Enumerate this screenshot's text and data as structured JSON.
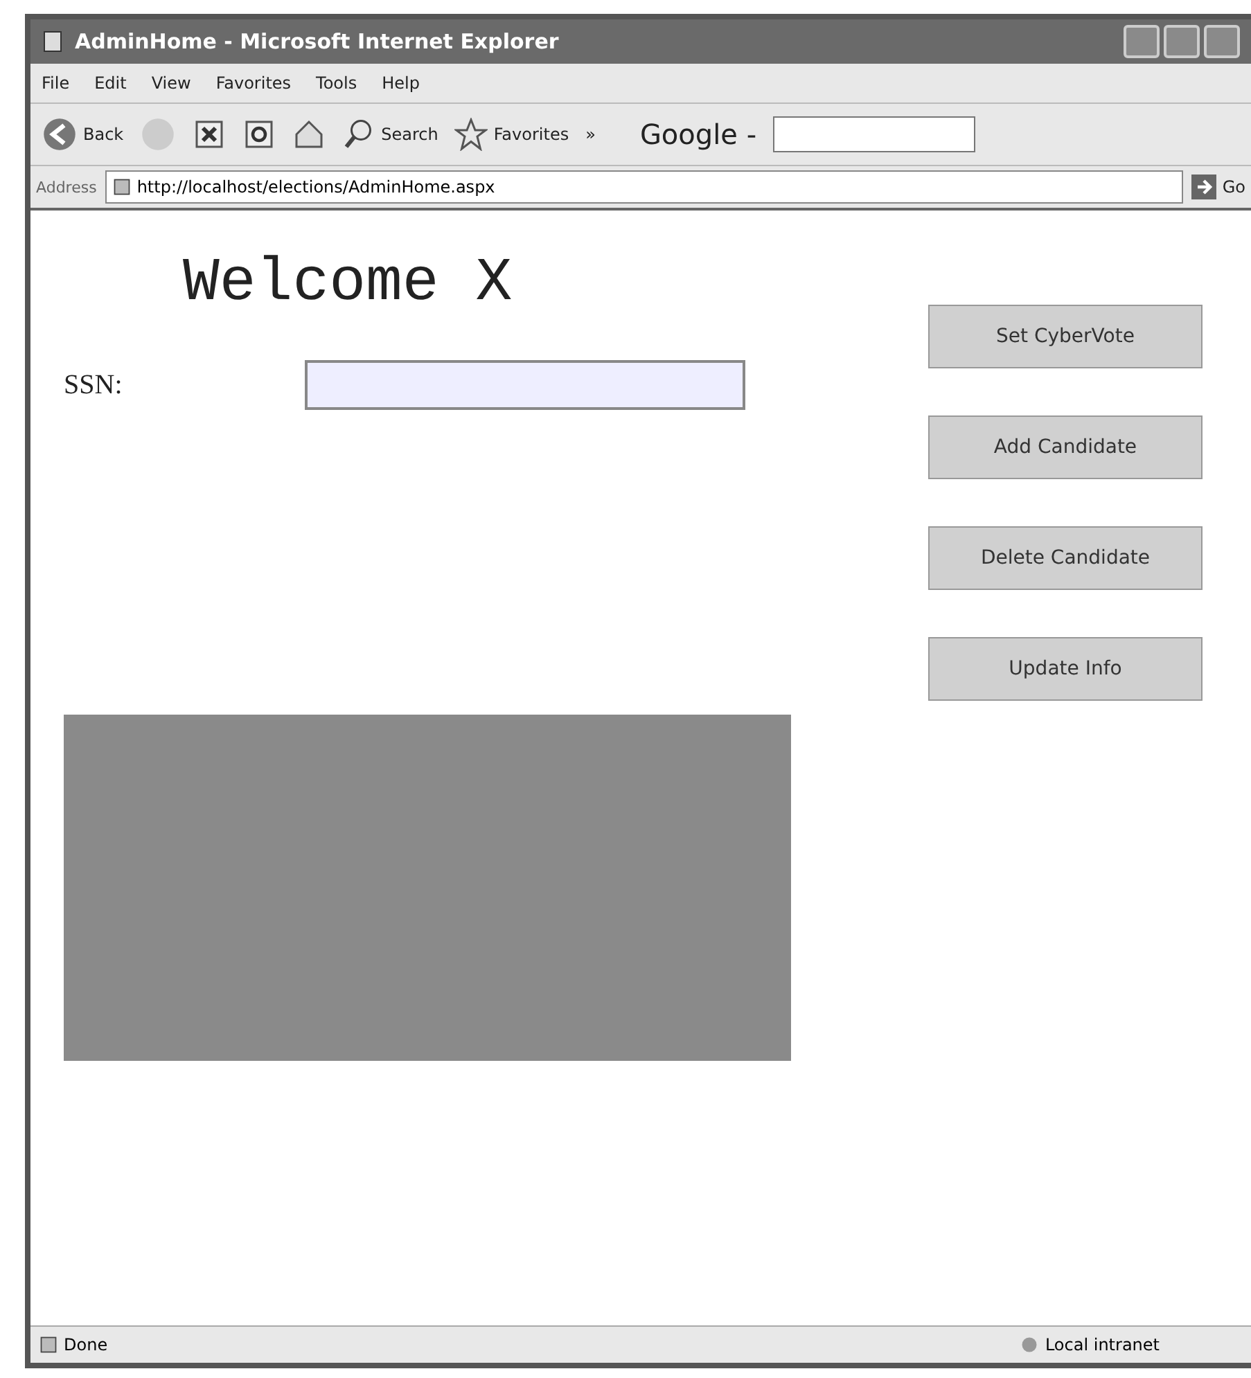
{
  "window": {
    "title": "AdminHome - Microsoft Internet Explorer"
  },
  "menu": [
    "File",
    "Edit",
    "View",
    "Favorites",
    "Tools",
    "Help"
  ],
  "toolbar": {
    "back": "Back",
    "search": "Search",
    "favorites": "Favorites",
    "chevron": "»",
    "google": "Google -"
  },
  "address": {
    "label": "Address",
    "url": "http://localhost/elections/AdminHome.aspx",
    "go": "Go"
  },
  "page": {
    "heading": "Welcome X",
    "ssn_label": "SSN:",
    "buttons": [
      "Set CyberVote",
      "Add Candidate",
      "Delete Candidate",
      "Update Info"
    ]
  },
  "status_bar": {
    "text": "Done",
    "zone": "Local intranet"
  }
}
